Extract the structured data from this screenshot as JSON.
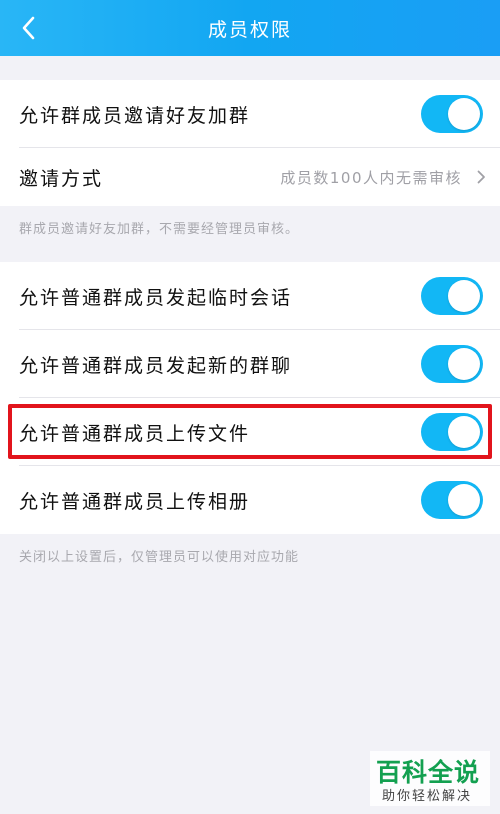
{
  "header": {
    "title": "成员权限",
    "back_icon": "chevron-left-icon"
  },
  "colors": {
    "accent": "#12b7f5",
    "highlight": "#e2141c",
    "watermark": "#13a050"
  },
  "group1": {
    "items": [
      {
        "label": "允许群成员邀请好友加群",
        "toggle_on": true
      },
      {
        "label": "邀请方式",
        "value": "成员数100人内无需审核"
      }
    ],
    "note": "群成员邀请好友加群，不需要经管理员审核。"
  },
  "group2": {
    "items": [
      {
        "label": "允许普通群成员发起临时会话",
        "toggle_on": true
      },
      {
        "label": "允许普通群成员发起新的群聊",
        "toggle_on": true
      },
      {
        "label": "允许普通群成员上传文件",
        "toggle_on": true
      },
      {
        "label": "允许普通群成员上传相册",
        "toggle_on": true
      }
    ],
    "note": "关闭以上设置后，仅管理员可以使用对应功能"
  },
  "watermark": {
    "main": "百科全说",
    "sub": "助你轻松解决"
  }
}
